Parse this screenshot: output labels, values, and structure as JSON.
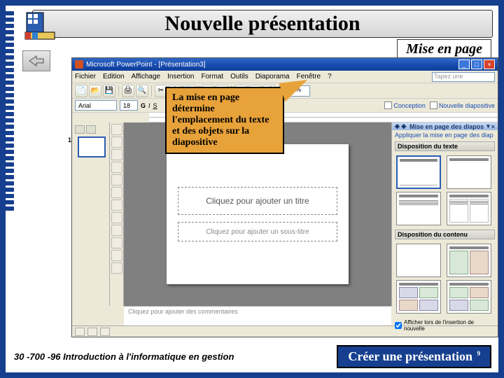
{
  "title": "Nouvelle présentation",
  "subtitle": "Mise en page",
  "callout_text": "La mise en page détermine l'emplacement du texte et des objets sur la diapositive",
  "ppt": {
    "window_title": "Microsoft PowerPoint - [Présentation3]",
    "menus": [
      "Fichier",
      "Edition",
      "Affichage",
      "Insertion",
      "Format",
      "Outils",
      "Diaporama",
      "Fenêtre",
      "?"
    ],
    "ask_placeholder": "Tapez une",
    "zoom": "39%",
    "font_name": "Arial",
    "font_size": "18",
    "conception_link": "Conception",
    "newslide_link": "Nouvelle diapositive",
    "thumb_number": "1",
    "slide_title_placeholder": "Cliquez pour ajouter un titre",
    "slide_subtitle_placeholder": "Cliquez pour ajouter un sous-titre",
    "notes_placeholder": "Cliquez pour ajouter des commentaires",
    "taskpane": {
      "header": "Mise en page des diapos",
      "apply_label": "Appliquer la mise en page des diap",
      "section_text": "Disposition du texte",
      "section_content": "Disposition du contenu",
      "checkbox_label": "Afficher lors de l'insertion de nouvelle"
    }
  },
  "footer_left": "30 -700 -96 Introduction à l'informatique en gestion",
  "footer_right": "Créer une présentation",
  "page_number": "9"
}
